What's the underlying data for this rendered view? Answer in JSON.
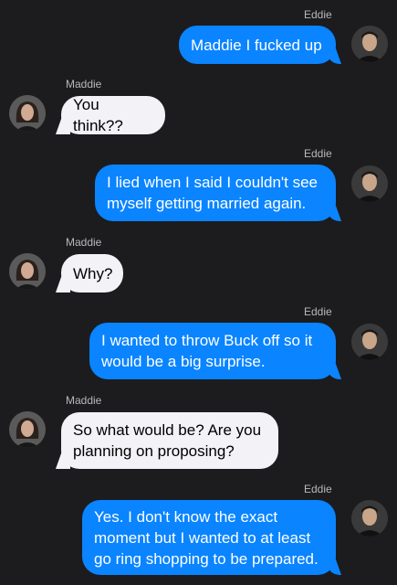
{
  "conversation": {
    "messages": [
      {
        "sender": "Eddie",
        "text": "Maddie I fucked up",
        "direction": "outgoing"
      },
      {
        "sender": "Maddie",
        "text": "You think??",
        "direction": "incoming"
      },
      {
        "sender": "Eddie",
        "text": "I lied when I said I couldn't see myself getting married again.",
        "direction": "outgoing"
      },
      {
        "sender": "Maddie",
        "text": "Why?",
        "direction": "incoming"
      },
      {
        "sender": "Eddie",
        "text": "I wanted to throw Buck off so it would be a big surprise.",
        "direction": "outgoing"
      },
      {
        "sender": "Maddie",
        "text": "So what would be? Are you planning on proposing?",
        "direction": "incoming"
      },
      {
        "sender": "Eddie",
        "text": "Yes. I don't know the exact moment but I wanted to at least go ring shopping to be prepared.",
        "direction": "outgoing"
      }
    ]
  },
  "colors": {
    "background": "#1c1c1e",
    "outgoing_bubble": "#0a84ff",
    "incoming_bubble": "#f2f2f7",
    "sender_label": "#b8b8bd"
  },
  "icons": {
    "eddie_avatar": "eddie-avatar-photo",
    "maddie_avatar": "maddie-avatar-photo"
  }
}
